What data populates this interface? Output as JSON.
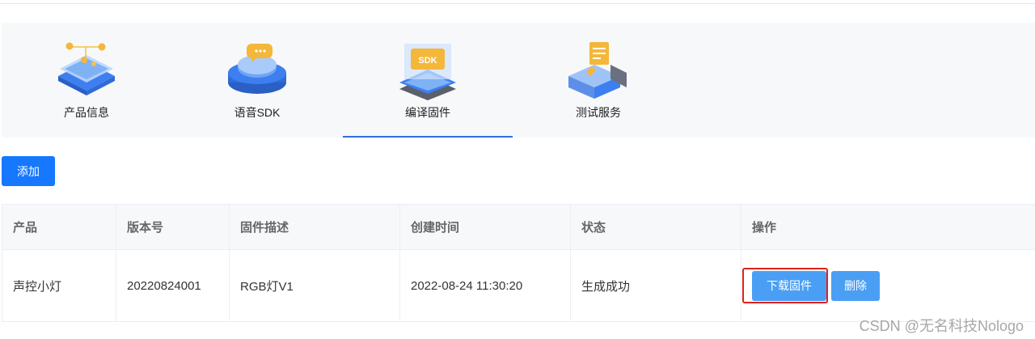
{
  "tabs": [
    {
      "label": "产品信息",
      "icon": "product-info-icon",
      "active": false
    },
    {
      "label": "语音SDK",
      "icon": "voice-sdk-icon",
      "active": false
    },
    {
      "label": "编译固件",
      "icon": "compile-firmware-icon",
      "active": true
    },
    {
      "label": "测试服务",
      "icon": "test-service-icon",
      "active": false
    }
  ],
  "sdk_badge": "SDK",
  "add_button": "添加",
  "table": {
    "headers": [
      "产品",
      "版本号",
      "固件描述",
      "创建时间",
      "状态",
      "操作"
    ],
    "rows": [
      {
        "product": "声控小灯",
        "version": "20220824001",
        "description": "RGB灯V1",
        "created": "2022-08-24 11:30:20",
        "status": "生成成功",
        "download_label": "下载固件",
        "delete_label": "删除"
      }
    ]
  },
  "watermark": "CSDN @无名科技Nologo",
  "colors": {
    "primary": "#1677ff",
    "action": "#4a9ff5",
    "highlight": "#e0201b",
    "active_tab_underline": "#2f6fe0"
  }
}
